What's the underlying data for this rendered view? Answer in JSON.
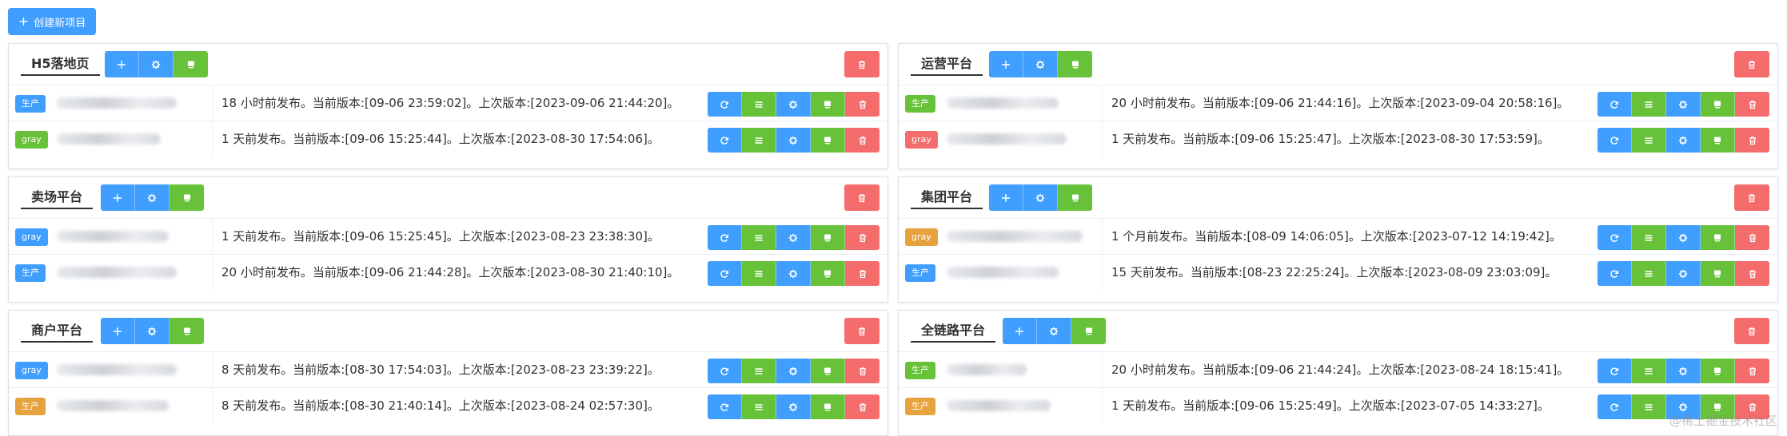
{
  "toolbar": {
    "create_label": "创建新项目"
  },
  "panels": [
    {
      "title": "H5落地页",
      "rows": [
        {
          "env": "生产",
          "env_color": "#409eff",
          "info": "18 小时前发布。当前版本:[09-06 23:59:02]。上次版本:[2023-09-06 21:44:20]。"
        },
        {
          "env": "gray",
          "env_color": "#67c23a",
          "info": "1 天前发布。当前版本:[09-06 15:25:44]。上次版本:[2023-08-30 17:54:06]。"
        }
      ]
    },
    {
      "title": "运营平台",
      "rows": [
        {
          "env": "生产",
          "env_color": "#67c23a",
          "info": "20 小时前发布。当前版本:[09-06 21:44:16]。上次版本:[2023-09-04 20:58:16]。"
        },
        {
          "env": "gray",
          "env_color": "#f56c6c",
          "info": "1 天前发布。当前版本:[09-06 15:25:47]。上次版本:[2023-08-30 17:53:59]。"
        }
      ]
    },
    {
      "title": "卖场平台",
      "rows": [
        {
          "env": "gray",
          "env_color": "#409eff",
          "info": "1 天前发布。当前版本:[09-06 15:25:45]。上次版本:[2023-08-23 23:38:30]。"
        },
        {
          "env": "生产",
          "env_color": "#409eff",
          "info": "20 小时前发布。当前版本:[09-06 21:44:28]。上次版本:[2023-08-30 21:40:10]。"
        }
      ]
    },
    {
      "title": "集团平台",
      "rows": [
        {
          "env": "gray",
          "env_color": "#e6a23c",
          "info": "1 个月前发布。当前版本:[08-09 14:06:05]。上次版本:[2023-07-12 14:19:42]。"
        },
        {
          "env": "生产",
          "env_color": "#409eff",
          "info": "15 天前发布。当前版本:[08-23 22:25:24]。上次版本:[2023-08-09 23:03:09]。"
        }
      ]
    },
    {
      "title": "商户平台",
      "rows": [
        {
          "env": "gray",
          "env_color": "#409eff",
          "info": "8 天前发布。当前版本:[08-30 17:54:03]。上次版本:[2023-08-23 23:39:22]。"
        },
        {
          "env": "生产",
          "env_color": "#e6a23c",
          "info": "8 天前发布。当前版本:[08-30 21:40:14]。上次版本:[2023-08-24 02:57:30]。"
        }
      ]
    },
    {
      "title": "全链路平台",
      "rows": [
        {
          "env": "生产",
          "env_color": "#67c23a",
          "info": "20 小时前发布。当前版本:[09-06 21:44:24]。上次版本:[2023-08-24 18:15:41]。"
        },
        {
          "env": "生产",
          "env_color": "#e6a23c",
          "info": "1 天前发布。当前版本:[09-06 15:25:49]。上次版本:[2023-07-05 14:33:27]。"
        }
      ]
    }
  ],
  "watermark": "@稀土掘金技术社区",
  "icons": {
    "add": "plus-icon",
    "settings": "gear-icon",
    "deploy": "monitor-icon",
    "delete": "trash-icon",
    "refresh": "refresh-icon",
    "list": "list-icon"
  },
  "colors": {
    "primary": "#409eff",
    "success": "#67c23a",
    "danger": "#f56c6c",
    "warning": "#e6a23c"
  }
}
